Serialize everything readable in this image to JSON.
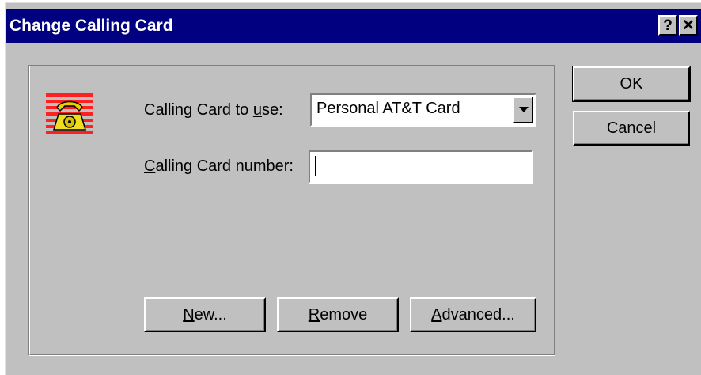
{
  "window": {
    "title": "Change Calling Card",
    "help_label": "?",
    "close_label": "✕"
  },
  "form": {
    "card_label_pre": "Calling Card to ",
    "card_label_u": "u",
    "card_label_post": "se:",
    "card_value": "Personal AT&T Card",
    "number_label_u": "C",
    "number_label_post": "alling Card number:",
    "number_value": ""
  },
  "buttons": {
    "new_u": "N",
    "new_post": "ew...",
    "remove_u": "R",
    "remove_post": "emove",
    "advanced_u": "A",
    "advanced_post": "dvanced...",
    "ok": "OK",
    "cancel": "Cancel"
  },
  "icons": {
    "card_icon": "telephone-icon",
    "dropdown_icon": "chevron-down-icon"
  },
  "colors": {
    "titlebar": "#000080",
    "face": "#c0c0c0"
  }
}
